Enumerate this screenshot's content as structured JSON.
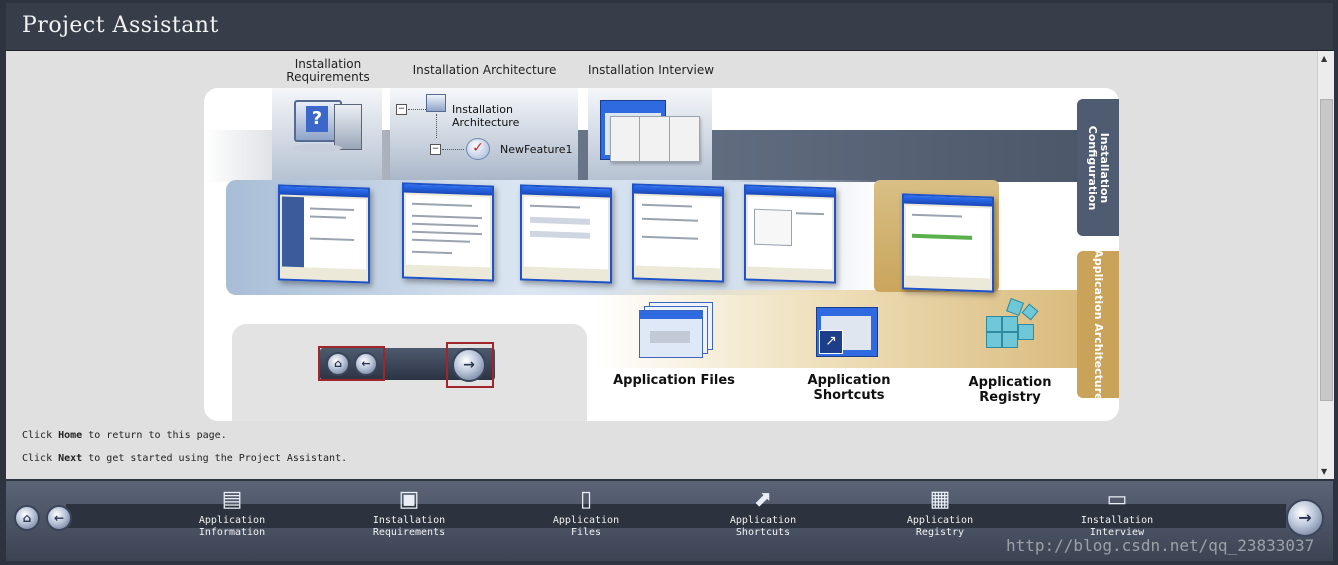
{
  "window": {
    "title": "Project Assistant"
  },
  "columns": {
    "installation_requirements": "Installation\nRequirements",
    "installation_architecture": "Installation Architecture",
    "installation_interview": "Installation Interview"
  },
  "tree": {
    "root": "Installation Architecture",
    "child": "NewFeature1"
  },
  "side_tabs": {
    "installation_configuration": "Installation\nConfiguration",
    "application_architecture": "Application Architecture"
  },
  "features": {
    "application_files": "Application Files",
    "application_shortcuts": "Application Shortcuts",
    "application_registry": "Application Registry"
  },
  "help": {
    "line1_prefix": "Click ",
    "line1_key": "Home",
    "line1_suffix": " to return to this page.",
    "line2_prefix": "Click ",
    "line2_key": "Next",
    "line2_suffix": " to get started using the Project Assistant."
  },
  "bottom_nav": [
    {
      "label": "Application\nInformation",
      "icon": "application-information-icon"
    },
    {
      "label": "Installation\nRequirements",
      "icon": "installation-requirements-icon"
    },
    {
      "label": "Application\nFiles",
      "icon": "application-files-icon"
    },
    {
      "label": "Application\nShortcuts",
      "icon": "application-shortcuts-icon"
    },
    {
      "label": "Application\nRegistry",
      "icon": "application-registry-icon"
    },
    {
      "label": "Installation\nInterview",
      "icon": "installation-interview-icon"
    }
  ],
  "watermark": "http://blog.csdn.net/qq_23833037",
  "colors": {
    "accent_gold": "#d6b573",
    "dark_band": "#4a5568",
    "highlight_box": "#a0262a"
  }
}
